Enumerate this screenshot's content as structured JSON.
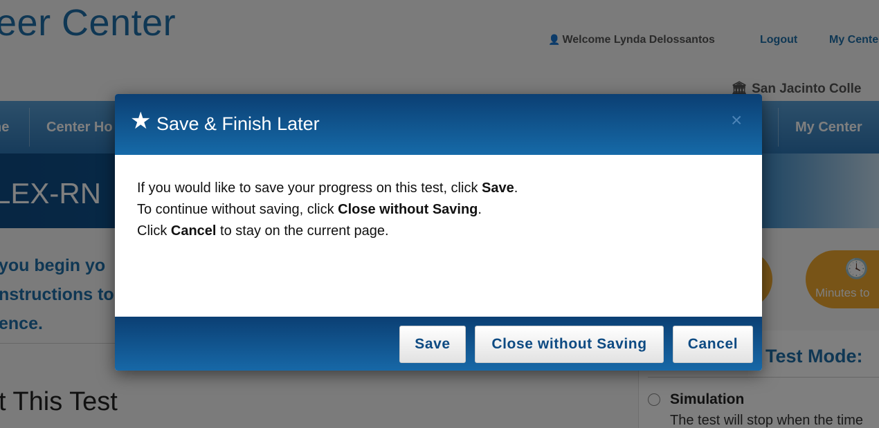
{
  "background": {
    "brand": "eer Center",
    "header": {
      "welcome": "Welcome Lynda Delossantos",
      "logout": "Logout",
      "my_center_link": "My Cente"
    },
    "college": "San Jacinto Colle",
    "nav": {
      "home": "ne",
      "center_home": "Center Ho",
      "my_center": "My Center"
    },
    "test_title": "LEX-RN",
    "intro_lines": [
      "you begin yo",
      "nstructions to",
      "ence."
    ],
    "about_heading": "t This Test",
    "timer_label": "Minutes to",
    "test_mode_heading": "Test Mode:",
    "simulation": {
      "label": "Simulation",
      "description": "The test will stop when the time"
    }
  },
  "modal": {
    "title": "Save & Finish Later",
    "close_symbol": "×",
    "body": {
      "line1_prefix": "If you would like to save your progress on this test, click ",
      "line1_bold": "Save",
      "line1_suffix": ".",
      "line2_prefix": "To continue without saving, click ",
      "line2_bold": "Close without Saving",
      "line2_suffix": ".",
      "line3_prefix": "Click ",
      "line3_bold": "Cancel",
      "line3_suffix": " to stay on the current page."
    },
    "buttons": {
      "save": "Save",
      "close_without_saving": "Close without Saving",
      "cancel": "Cancel"
    }
  },
  "icons": {
    "star": "star-icon",
    "close": "close-icon",
    "user": "user-icon",
    "institution": "institution-icon",
    "clock": "clock-icon"
  },
  "colors": {
    "brand_blue": "#1f6fa8",
    "modal_header": "#0b3f73",
    "button_text": "#0d4a82",
    "timer_orange": "#f0a92f"
  }
}
